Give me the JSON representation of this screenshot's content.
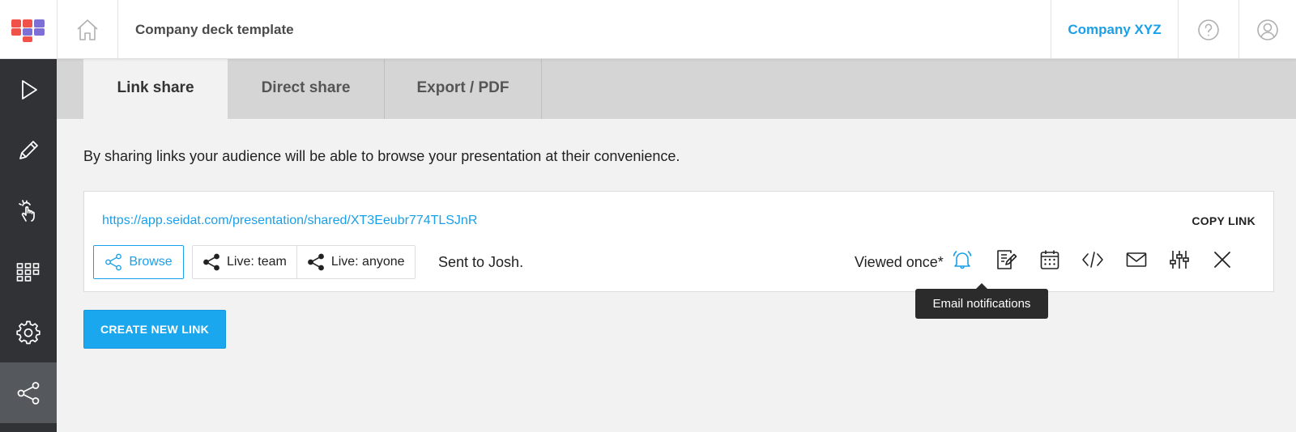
{
  "header": {
    "logo_icon": "seidat-logo-icon",
    "home_icon": "home-icon",
    "document_title": "Company deck template",
    "company_name": "Company XYZ",
    "help_icon": "help-circle-icon",
    "user_icon": "user-avatar-icon"
  },
  "sidebar": {
    "items": [
      {
        "icon": "play-icon",
        "active": false
      },
      {
        "icon": "pencil-icon",
        "active": false
      },
      {
        "icon": "touch-icon",
        "active": false
      },
      {
        "icon": "grid-icon",
        "active": false
      },
      {
        "icon": "gear-icon",
        "active": false
      },
      {
        "icon": "share-icon",
        "active": true
      }
    ]
  },
  "tabs": [
    {
      "label": "Link share",
      "active": true
    },
    {
      "label": "Direct share",
      "active": false
    },
    {
      "label": "Export / PDF",
      "active": false
    }
  ],
  "intro_text": "By sharing links your audience will be able to browse your presentation at their convenience.",
  "link_card": {
    "url": "https://app.seidat.com/presentation/shared/XT3Eeubr774TLSJnR",
    "copy_label": "COPY LINK",
    "browse_label": "Browse",
    "live_team_label": "Live: team",
    "live_anyone_label": "Live: anyone",
    "sent_text": "Sent to Josh.",
    "viewed_text": "Viewed once*",
    "actions": [
      {
        "icon": "bell-icon",
        "active": true
      },
      {
        "icon": "notes-icon",
        "active": false
      },
      {
        "icon": "calendar-icon",
        "active": false
      },
      {
        "icon": "code-icon",
        "active": false
      },
      {
        "icon": "mail-icon",
        "active": false
      },
      {
        "icon": "sliders-icon",
        "active": false
      },
      {
        "icon": "close-icon",
        "active": false
      }
    ]
  },
  "tooltip": {
    "text": "Email notifications"
  },
  "create_button_label": "CREATE NEW LINK",
  "colors": {
    "accent": "#1aa0e8",
    "sidebar_bg": "#303236",
    "sidebar_active_bg": "#55585d",
    "tabbar_bg": "#d5d5d5",
    "page_bg": "#f2f2f2",
    "tooltip_bg": "#2b2b2b",
    "logo_red": "#f0524a",
    "logo_purple": "#7e6fd6"
  }
}
